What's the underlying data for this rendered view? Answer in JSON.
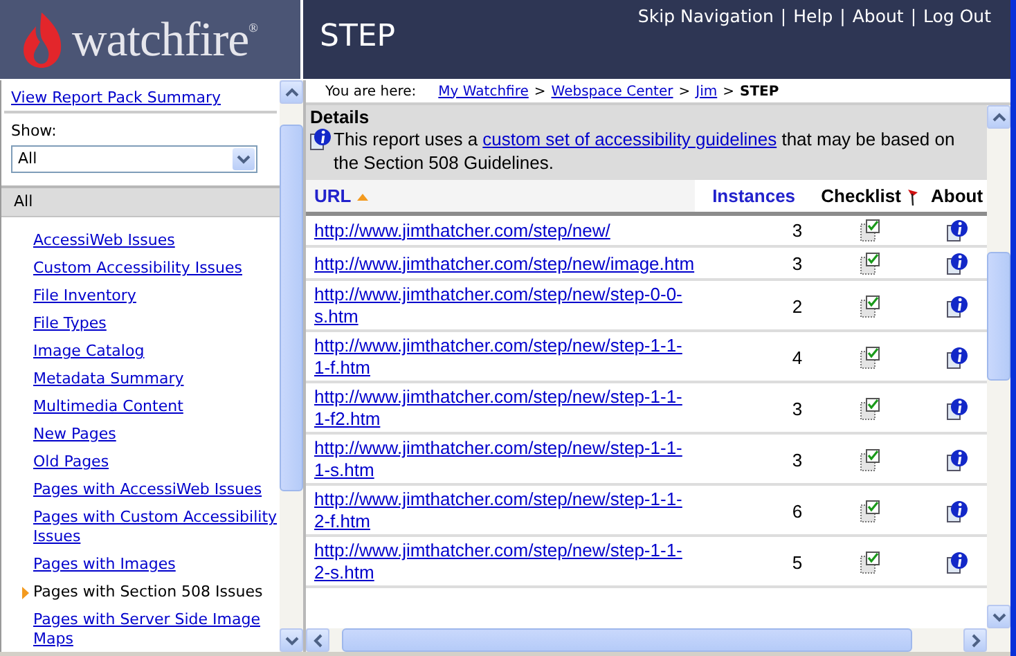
{
  "header": {
    "logo": "watchfire",
    "logo_mark": "®",
    "title": "STEP",
    "separator": "|",
    "links": [
      "Skip Navigation",
      "Help",
      "About",
      "Log Out"
    ]
  },
  "sidebar": {
    "summary_link": "View Report Pack Summary",
    "show_label": "Show:",
    "show_value": "All",
    "section": "All",
    "items": [
      {
        "label": "AccessiWeb Issues",
        "selected": false
      },
      {
        "label": "Custom Accessibility Issues",
        "selected": false
      },
      {
        "label": "File Inventory",
        "selected": false
      },
      {
        "label": "File Types",
        "selected": false
      },
      {
        "label": "Image Catalog",
        "selected": false
      },
      {
        "label": "Metadata Summary",
        "selected": false
      },
      {
        "label": "Multimedia Content",
        "selected": false
      },
      {
        "label": "New Pages",
        "selected": false
      },
      {
        "label": "Old Pages",
        "selected": false
      },
      {
        "label": "Pages with AccessiWeb Issues",
        "selected": false
      },
      {
        "label": "Pages with Custom Accessibility Issues",
        "selected": false
      },
      {
        "label": "Pages with Images",
        "selected": false
      },
      {
        "label": "Pages with Section 508 Issues",
        "selected": true
      },
      {
        "label": "Pages with Server Side Image Maps",
        "selected": false
      }
    ]
  },
  "breadcrumb": {
    "label": "You are here:",
    "separator": ">",
    "links": [
      "My Watchfire",
      "Webspace Center",
      "Jim"
    ],
    "current": "STEP"
  },
  "details": {
    "title": "Details",
    "text_before": "This report uses a ",
    "link": "custom set of accessibility guidelines",
    "text_after": " that may be based on the Section 508 Guidelines."
  },
  "table": {
    "columns": [
      {
        "label": "URL",
        "kind": "sorted"
      },
      {
        "label": "Instances",
        "kind": "link"
      },
      {
        "label": "Checklist",
        "kind": "flagged"
      },
      {
        "label": "About",
        "kind": "plain"
      }
    ],
    "rows": [
      {
        "url": "http://www.jimthatcher.com/step/new/",
        "instances": "3"
      },
      {
        "url": "http://www.jimthatcher.com/step/new/image.htm",
        "instances": "3"
      },
      {
        "url": "http://www.jimthatcher.com/step/new/step-0-0-s.htm",
        "instances": "2"
      },
      {
        "url": "http://www.jimthatcher.com/step/new/step-1-1-1-f.htm",
        "instances": "4"
      },
      {
        "url": "http://www.jimthatcher.com/step/new/step-1-1-1-f2.htm",
        "instances": "3"
      },
      {
        "url": "http://www.jimthatcher.com/step/new/step-1-1-1-s.htm",
        "instances": "3"
      },
      {
        "url": "http://www.jimthatcher.com/step/new/step-1-1-2-f.htm",
        "instances": "6"
      },
      {
        "url": "http://www.jimthatcher.com/step/new/step-1-1-2-s.htm",
        "instances": "5"
      }
    ]
  }
}
